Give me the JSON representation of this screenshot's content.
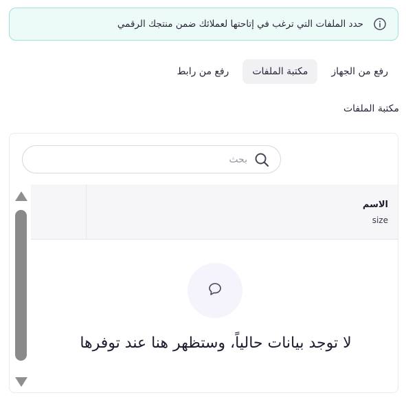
{
  "banner": {
    "text": "حدد الملفات التي ترغب في إتاحتها لعملائك ضمن منتجك الرقمي",
    "icon": "info-icon"
  },
  "tabs": [
    {
      "label": "رفع من الجهاز",
      "active": false
    },
    {
      "label": "مكتبة الملفات",
      "active": true
    },
    {
      "label": "رفع من رابط",
      "active": false
    }
  ],
  "section_title": "مكتبة الملفات",
  "search": {
    "placeholder": "بحث",
    "icon": "search-icon"
  },
  "table": {
    "columns": [
      {
        "label": "الاسم",
        "sublabel": "size"
      }
    ]
  },
  "empty_state": {
    "icon": "chat-bubble-icon",
    "text": "لا توجد بيانات حالياً، وستظهر هنا عند توفرها"
  },
  "colors": {
    "banner_bg": "#edfbf8",
    "banner_border": "#9ee3d8",
    "active_tab_bg": "#f1f0f3",
    "empty_circle_bg": "#f5f3fb"
  }
}
